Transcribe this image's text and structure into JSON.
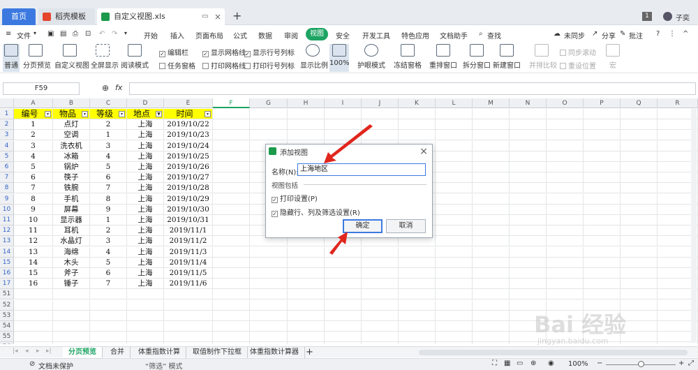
{
  "titlebar": {
    "tabs": [
      {
        "label": "首页"
      },
      {
        "label": "稻壳模板"
      },
      {
        "label": "自定义视图.xls"
      }
    ],
    "page_badge": "1",
    "user": "子奕"
  },
  "menu": {
    "file": "文件",
    "items": [
      "开始",
      "插入",
      "页面布局",
      "公式",
      "数据",
      "审阅",
      "视图",
      "安全",
      "开发工具",
      "特色应用",
      "文档助手"
    ],
    "active": "视图",
    "search": "查找",
    "sync": "未同步",
    "share": "分享",
    "annotate": "批注"
  },
  "ribbon": {
    "buttons": [
      "普通",
      "分页预览",
      "自定义视图",
      "全屏显示",
      "阅读模式",
      "显示比例",
      "100%",
      "护眼模式",
      "冻结窗格",
      "重排窗口",
      "拆分窗口",
      "新建窗口",
      "并排比较",
      "同步滚动",
      "重设位置",
      "宏"
    ],
    "checks": [
      {
        "label": "编辑栏",
        "checked": true
      },
      {
        "label": "显示网格线",
        "checked": true
      },
      {
        "label": "显示行号列标",
        "checked": true
      },
      {
        "label": "任务窗格",
        "checked": false
      },
      {
        "label": "打印网格线",
        "checked": false
      },
      {
        "label": "打印行号列标",
        "checked": false
      }
    ]
  },
  "formula": {
    "cell_ref": "F59",
    "fx": "fx"
  },
  "sheet": {
    "columns": [
      "A",
      "B",
      "C",
      "D",
      "E",
      "F",
      "G",
      "H",
      "I",
      "J",
      "K",
      "L",
      "M",
      "N",
      "O",
      "P",
      "Q",
      "R"
    ],
    "headers": [
      "编号",
      "物品",
      "等级",
      "地点",
      "时间"
    ],
    "rows": [
      [
        "1",
        "点灯",
        "2",
        "上海",
        "2019/10/22"
      ],
      [
        "2",
        "空调",
        "1",
        "上海",
        "2019/10/23"
      ],
      [
        "3",
        "洗衣机",
        "3",
        "上海",
        "2019/10/24"
      ],
      [
        "4",
        "冰箱",
        "4",
        "上海",
        "2019/10/25"
      ],
      [
        "5",
        "锅炉",
        "5",
        "上海",
        "2019/10/26"
      ],
      [
        "6",
        "筷子",
        "6",
        "上海",
        "2019/10/27"
      ],
      [
        "7",
        "铁腕",
        "7",
        "上海",
        "2019/10/28"
      ],
      [
        "8",
        "手机",
        "8",
        "上海",
        "2019/10/29"
      ],
      [
        "9",
        "屏幕",
        "9",
        "上海",
        "2019/10/30"
      ],
      [
        "10",
        "显示器",
        "1",
        "上海",
        "2019/10/31"
      ],
      [
        "11",
        "耳机",
        "2",
        "上海",
        "2019/11/1"
      ],
      [
        "12",
        "水晶灯",
        "3",
        "上海",
        "2019/11/2"
      ],
      [
        "13",
        "海绵",
        "4",
        "上海",
        "2019/11/3"
      ],
      [
        "14",
        "木头",
        "5",
        "上海",
        "2019/11/4"
      ],
      [
        "15",
        "斧子",
        "6",
        "上海",
        "2019/11/5"
      ],
      [
        "16",
        "锤子",
        "7",
        "上海",
        "2019/11/6"
      ]
    ],
    "row_numbers": [
      "1",
      "2",
      "3",
      "4",
      "5",
      "6",
      "7",
      "8",
      "9",
      "10",
      "11",
      "12",
      "13",
      "14",
      "15",
      "16",
      "17",
      "51",
      "52",
      "53",
      "54",
      "55",
      "56",
      "57",
      "58"
    ]
  },
  "sheet_tabs": [
    "分页预览",
    "合并",
    "体重指数计算",
    "取值制作下拉框",
    "体重指数计算器"
  ],
  "status": {
    "protect": "文档未保护",
    "mode": "“筛选” 模式",
    "zoom": "100%"
  },
  "dialog": {
    "title": "添加视图",
    "name_label": "名称(N):",
    "name_value": "上海地区",
    "section": "视图包括",
    "opt_print": "打印设置(P)",
    "opt_hidden": "隐藏行、列及筛选设置(R)",
    "ok": "确定",
    "cancel": "取消"
  },
  "watermark": {
    "text": "Bai 经验",
    "url": "jingyan.baidu.com"
  }
}
